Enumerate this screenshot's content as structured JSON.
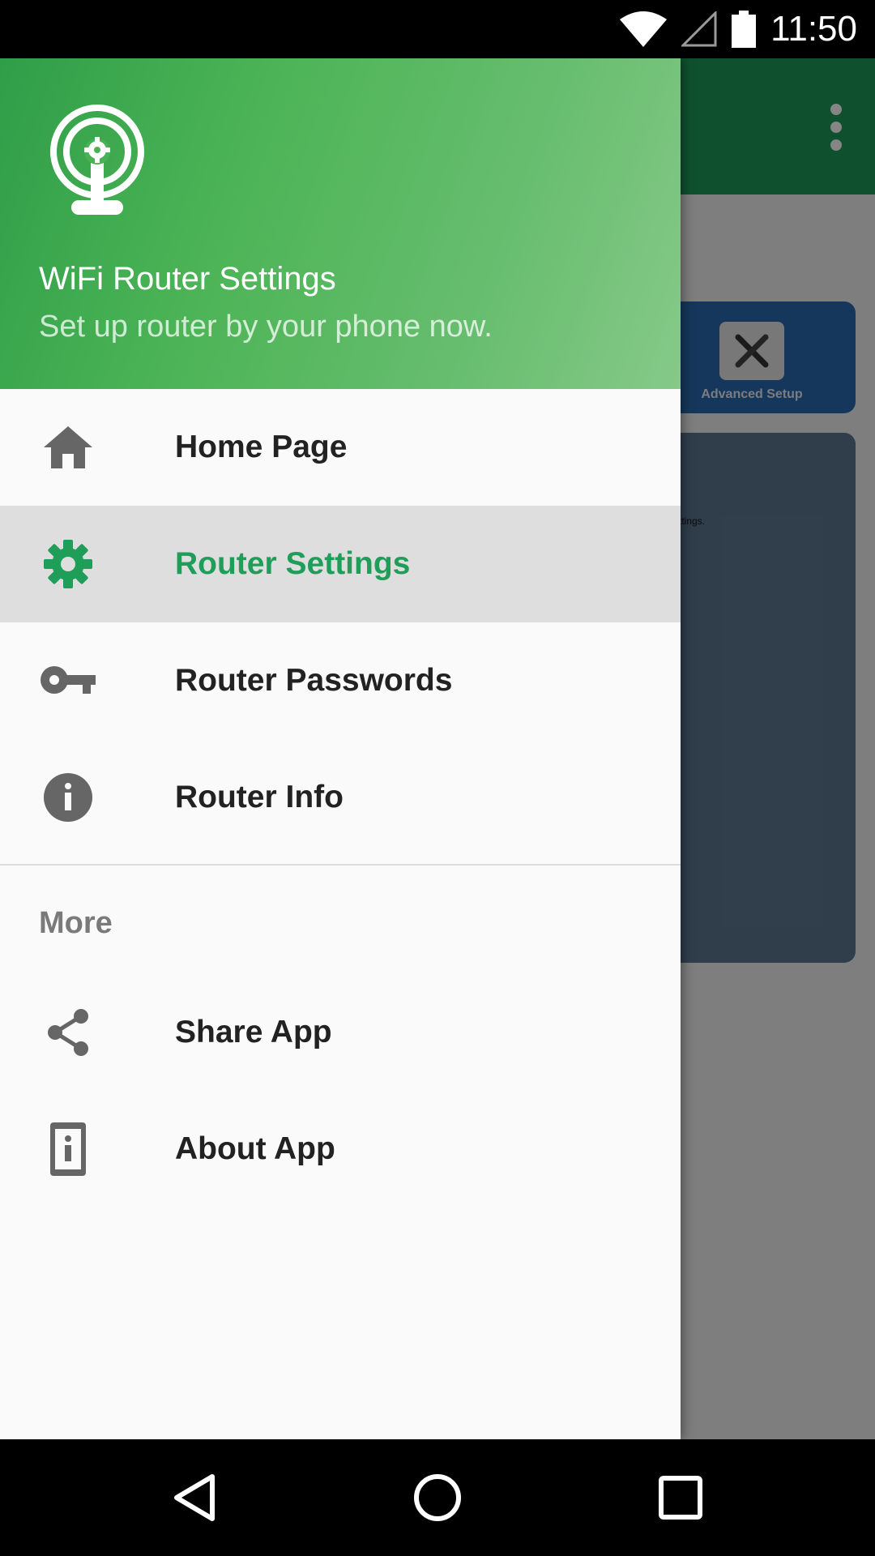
{
  "status_bar": {
    "time": "11:50",
    "icons": [
      "wifi-icon",
      "cellular-signal-icon",
      "battery-icon"
    ]
  },
  "background": {
    "toolbar_color": "#1e9c58",
    "advanced_setup_label": "Advanced Setup",
    "settings_text": "ttings."
  },
  "drawer": {
    "header": {
      "title": "WiFi Router Settings",
      "subtitle": "Set up router by your phone now.",
      "logo_icon": "router-settings-logo-icon"
    },
    "items": [
      {
        "label": "Home Page",
        "icon": "home-icon",
        "active": false
      },
      {
        "label": "Router Settings",
        "icon": "gear-icon",
        "active": true
      },
      {
        "label": "Router Passwords",
        "icon": "key-icon",
        "active": false
      },
      {
        "label": "Router Info",
        "icon": "info-icon",
        "active": false
      }
    ],
    "section_title": "More",
    "more_items": [
      {
        "label": "Share App",
        "icon": "share-icon"
      },
      {
        "label": "About App",
        "icon": "about-phone-icon"
      }
    ]
  },
  "colors": {
    "accent": "#1f9e5a",
    "active_bg": "#dedede"
  },
  "nav_bar": {
    "buttons": [
      "back-icon",
      "home-circle-icon",
      "recents-icon"
    ]
  }
}
